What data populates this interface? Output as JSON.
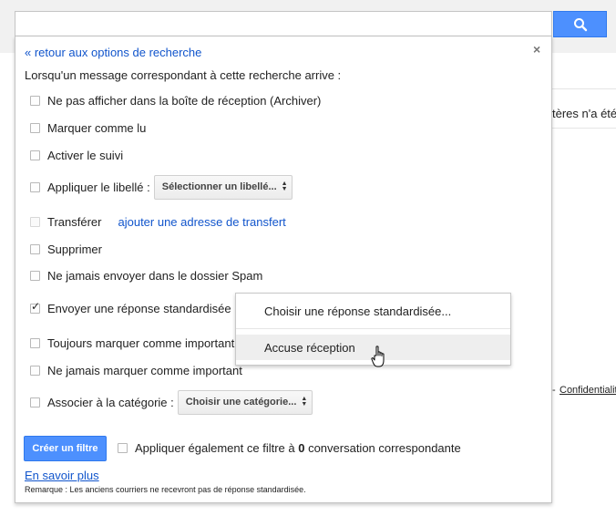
{
  "background": {
    "partial_text": "tères n'a été",
    "separator": "-",
    "privacy_link": "Confidentialité"
  },
  "search": {
    "value": "",
    "button_icon": "search-icon",
    "accent_color": "#4d90fe"
  },
  "panel": {
    "back_link": "« retour aux options de recherche",
    "close_label": "×",
    "intro": "Lorsqu'un message correspondant à cette recherche arrive :",
    "options": [
      {
        "label": "Ne pas afficher dans la boîte de réception (Archiver)",
        "checked": false
      },
      {
        "label": "Marquer comme lu",
        "checked": false
      },
      {
        "label": "Activer le suivi",
        "checked": false
      },
      {
        "label": "Appliquer le libellé :",
        "checked": false,
        "select": "Sélectionner un libellé..."
      },
      {
        "label": "Transférer",
        "checked": false,
        "disabled": true,
        "link": "ajouter une adresse de transfert"
      },
      {
        "label": "Supprimer",
        "checked": false
      },
      {
        "label": "Ne jamais envoyer dans le dossier Spam",
        "checked": false
      },
      {
        "label": "Envoyer une réponse standardisée :",
        "checked": true
      },
      {
        "label": "Toujours marquer comme important",
        "checked": false
      },
      {
        "label": "Ne jamais marquer comme important",
        "checked": false
      },
      {
        "label": "Associer à la catégorie :",
        "checked": false,
        "select": "Choisir une catégorie..."
      }
    ],
    "create_button": "Créer un filtre",
    "apply_prefix": "Appliquer également ce filtre à ",
    "apply_count": "0",
    "apply_suffix": " conversation correspondante",
    "learn_more": "En savoir plus",
    "remark": "Remarque : Les anciens courriers ne recevront pas de réponse standardisée."
  },
  "canned_menu": {
    "items": [
      "Choisir une réponse standardisée...",
      "Accuse réception"
    ],
    "hovered_index": 1
  }
}
